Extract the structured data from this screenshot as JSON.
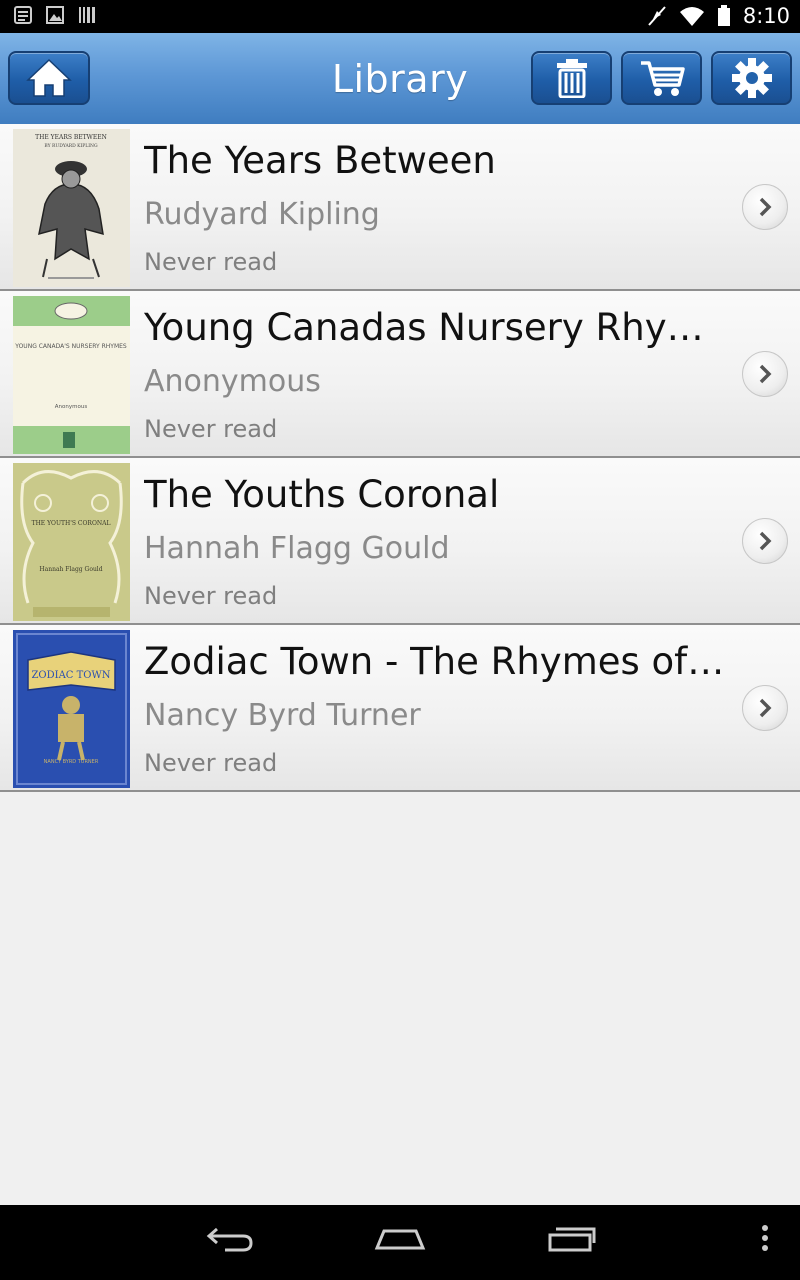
{
  "status_bar": {
    "time": "8:10"
  },
  "action_bar": {
    "title": "Library"
  },
  "books": [
    {
      "title": "The Years Between",
      "author": "Rudyard Kipling",
      "status": "Never read",
      "cover_text": "THE YEARS BETWEEN",
      "cover_subtext": "BY RUDYARD KIPLING",
      "cover_color": "#e9e6d9"
    },
    {
      "title": "Young Canadas Nursery Rhym…",
      "author": "Anonymous",
      "status": "Never read",
      "cover_text": "YOUNG CANADA'S NURSERY RHYMES",
      "cover_subtext": "Anonymous",
      "cover_color": "#9ccd8a"
    },
    {
      "title": "The Youths Coronal",
      "author": "Hannah Flagg Gould",
      "status": "Never read",
      "cover_text": "THE YOUTH'S CORONAL",
      "cover_subtext": "Hannah Flagg Gould",
      "cover_color": "#c9c98a"
    },
    {
      "title": "Zodiac Town - The Rhymes of…",
      "author": "Nancy Byrd Turner",
      "status": "Never read",
      "cover_text": "ZODIAC TOWN",
      "cover_subtext": "NANCY BYRD TURNER",
      "cover_color": "#2a4fb0"
    }
  ],
  "colors": {
    "accent": "#3f7dc0",
    "title_text": "#111111",
    "secondary_text": "#8a8a8a"
  }
}
